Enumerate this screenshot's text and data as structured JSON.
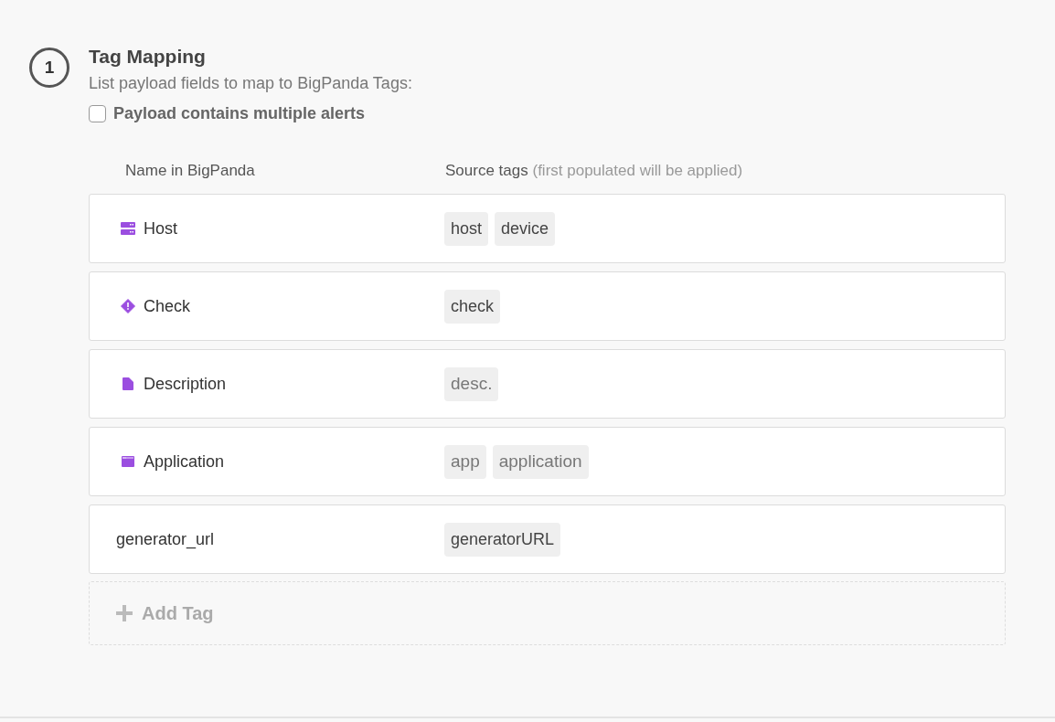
{
  "step": {
    "number": "1",
    "title": "Tag Mapping",
    "description": "List payload fields to map to BigPanda Tags:"
  },
  "multiple_alerts": {
    "label": "Payload contains multiple alerts",
    "checked": false
  },
  "columns": {
    "name": "Name in BigPanda",
    "source": "Source tags",
    "source_hint": "(first populated will be applied)"
  },
  "rows": [
    {
      "name": "Host",
      "kind": "server",
      "tags": [
        {
          "label": "host",
          "muted": false
        },
        {
          "label": "device",
          "muted": false
        }
      ]
    },
    {
      "name": "Check",
      "kind": "alert",
      "tags": [
        {
          "label": "check",
          "muted": false
        }
      ]
    },
    {
      "name": "Description",
      "kind": "document",
      "tags": [
        {
          "label": "desc.",
          "muted": true
        }
      ]
    },
    {
      "name": "Application",
      "kind": "window",
      "tags": [
        {
          "label": "app",
          "muted": true
        },
        {
          "label": "application",
          "muted": true
        }
      ]
    },
    {
      "name": "generator_url",
      "kind": "custom",
      "tags": [
        {
          "label": "generatorURL",
          "muted": false
        }
      ]
    }
  ],
  "add_button": {
    "label": "Add Tag"
  }
}
